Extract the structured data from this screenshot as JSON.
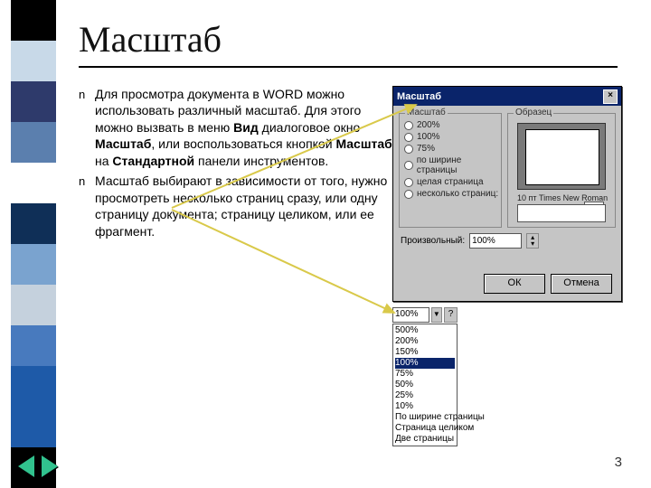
{
  "stripe_colors": [
    "#000000",
    "#c8d9e8",
    "#2e3a6b",
    "#5b7fae",
    "#ffffff",
    "#0f2f57",
    "#7aa3cf",
    "#c5d1dd",
    "#487abe",
    "#1e5aa8",
    "#1e5aa8",
    "#000000"
  ],
  "title": "Масштаб",
  "bullets": [
    {
      "parts": [
        {
          "t": "Для просмотра документа в "
        },
        {
          "t": "WORD ",
          "b": false
        },
        {
          "t": "можно использовать различный масштаб. Для этого можно вызвать в меню "
        },
        {
          "t": "Вид",
          "b": true
        },
        {
          "t": " диалоговое окно "
        },
        {
          "t": "Масштаб",
          "b": true
        },
        {
          "t": ", или воспользоваться кнопкой "
        },
        {
          "t": "Масштаба",
          "b": true
        },
        {
          "t": " на "
        },
        {
          "t": "Стандартной",
          "b": true
        },
        {
          "t": " панели инструментов."
        }
      ]
    },
    {
      "parts": [
        {
          "t": "Масштаб выбирают в зависимости от того, нужно просмотреть несколько страниц сразу, или одну страницу документа; страницу целиком, или ее фрагмент."
        }
      ]
    }
  ],
  "dialog": {
    "title": "Масштаб",
    "group1_label": "Масштаб",
    "group2_label": "Образец",
    "radios": [
      "200%",
      "100%",
      "75%",
      "по ширине страницы",
      "целая страница",
      "несколько страниц:"
    ],
    "sample_label": "10 пт Times New Roman",
    "arbitrary_label": "Произвольный:",
    "arbitrary_value": "100%",
    "ok": "ОК",
    "cancel": "Отмена"
  },
  "zoom_dropdown": {
    "selected": "100%",
    "help": "?",
    "items": [
      "500%",
      "200%",
      "150%",
      "100%",
      "75%",
      "50%",
      "25%",
      "10%",
      "По ширине страницы",
      "Страница целиком",
      "Две страницы"
    ],
    "highlighted_index": 3
  },
  "page_number": "3"
}
